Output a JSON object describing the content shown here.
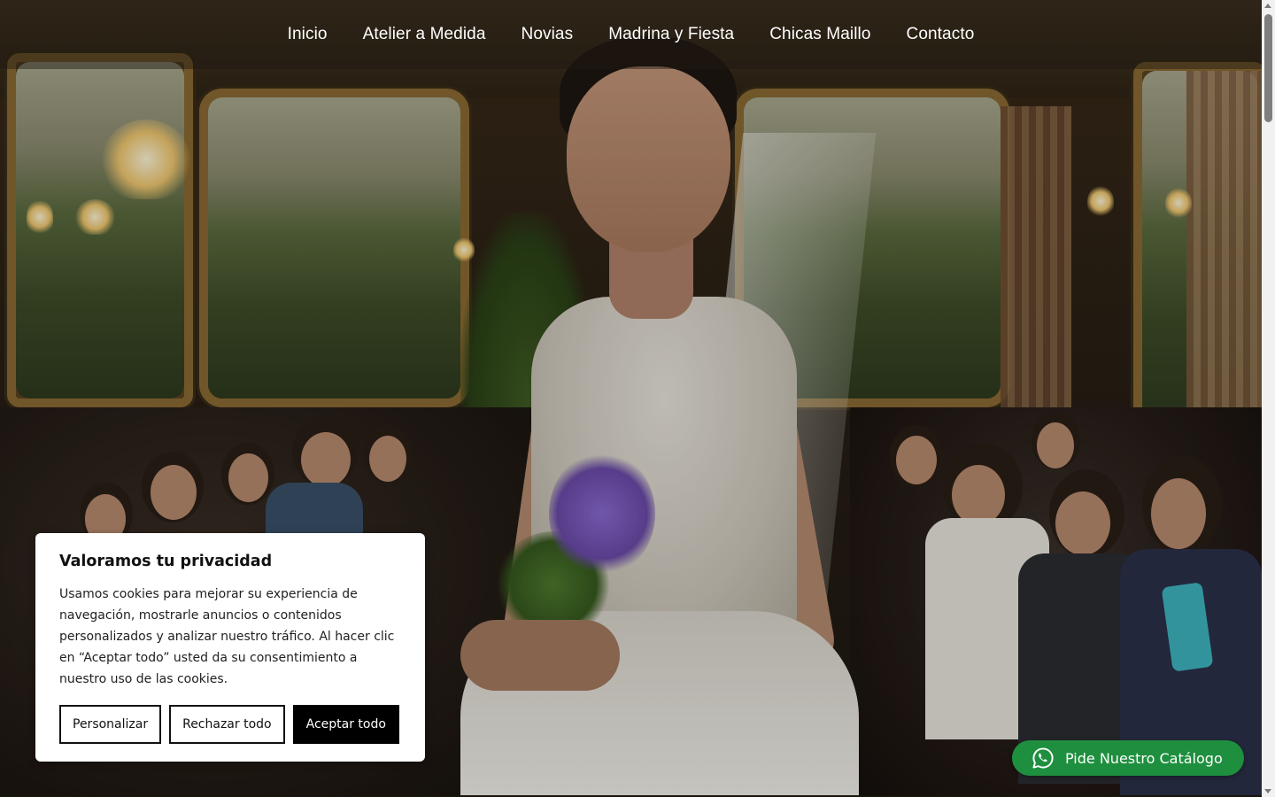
{
  "nav": {
    "items": [
      {
        "label": "Inicio"
      },
      {
        "label": "Atelier a Medida"
      },
      {
        "label": "Novias"
      },
      {
        "label": "Madrina y Fiesta"
      },
      {
        "label": "Chicas Maillo"
      },
      {
        "label": "Contacto"
      }
    ]
  },
  "cookie_banner": {
    "title": "Valoramos tu privacidad",
    "body": "Usamos cookies para mejorar su experiencia de navegación, mostrarle anuncios o contenidos personalizados y analizar nuestro tráfico. Al hacer clic en “Aceptar todo” usted da su consentimiento a nuestro uso de las cookies.",
    "customize_label": "Personalizar",
    "reject_label": "Rechazar todo",
    "accept_label": "Aceptar todo"
  },
  "whatsapp_button": {
    "label": "Pide Nuestro Catálogo",
    "icon": "whatsapp-icon",
    "color": "#1e8f3e"
  },
  "hero": {
    "image": "bride-runway-photo"
  }
}
